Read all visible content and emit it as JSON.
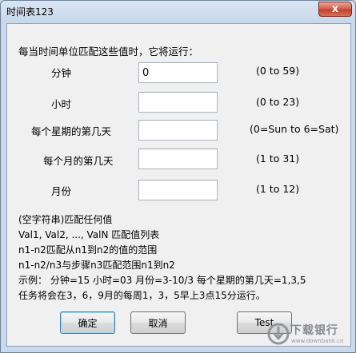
{
  "window": {
    "title": "时间表123",
    "close_symbol": "x"
  },
  "intro": "每当时间单位匹配这些值时，它将运行：",
  "fields": [
    {
      "label": "分钟",
      "value": "0",
      "range": "(0 to 59)"
    },
    {
      "label": "小时",
      "value": "",
      "range": "(0 to 23)"
    },
    {
      "label": "每个星期的第几天",
      "value": "",
      "range": "(0=Sun to 6=Sat)"
    },
    {
      "label": "每个月的第几天",
      "value": "",
      "range": "(1 to 31)"
    },
    {
      "label": "月份",
      "value": "",
      "range": "(1 to 12)"
    }
  ],
  "help": [
    "(空字符串)匹配任何值",
    "Val1, Val2, ..., ValN 匹配值列表",
    "n1-n2匹配从n1到n2的值的范围",
    "n1-n2/n3与步骤n3匹配范围n1到n2",
    "示例： 分钟=15 小时=03 月份=3-10/3 每个星期的第几天=1,3,5",
    "任务将会在3，6，9月的每周1，3，5早上3点15分运行。"
  ],
  "buttons": {
    "ok": "确定",
    "cancel": "取消",
    "test": "Test"
  },
  "watermark": {
    "brand": "下载银行",
    "site": "www.downbank.cn"
  }
}
